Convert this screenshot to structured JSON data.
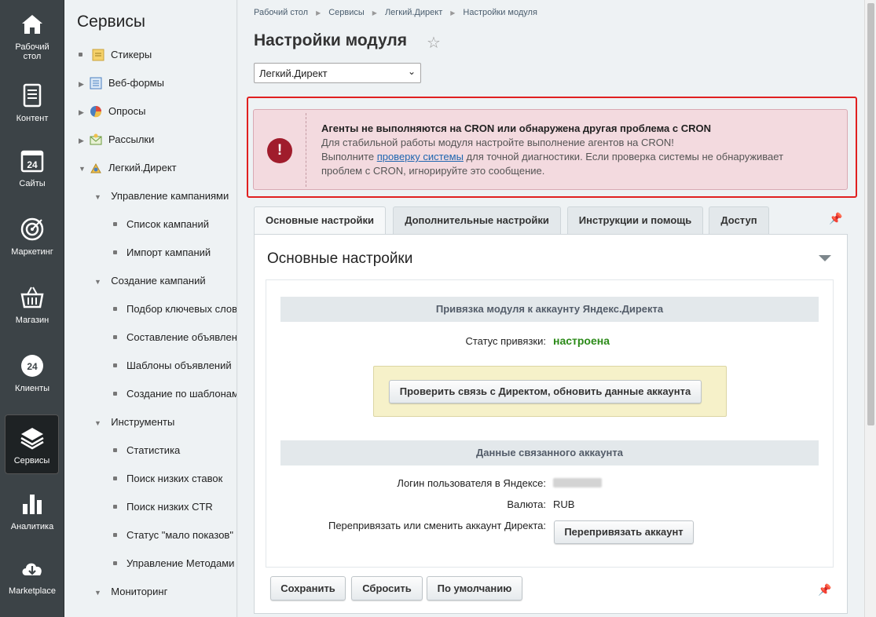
{
  "rail": [
    {
      "label_l1": "Рабочий",
      "label_l2": "стол",
      "icon": "home-icon"
    },
    {
      "label_l1": "Контент",
      "label_l2": "",
      "icon": "document-icon"
    },
    {
      "label_l1": "Сайты",
      "label_l2": "",
      "icon": "calendar-24-icon",
      "icon_text": "24"
    },
    {
      "label_l1": "Маркетинг",
      "label_l2": "",
      "icon": "target-icon"
    },
    {
      "label_l1": "Магазин",
      "label_l2": "",
      "icon": "basket-icon"
    },
    {
      "label_l1": "Клиенты",
      "label_l2": "",
      "icon": "crm-24-icon",
      "icon_text": "24"
    },
    {
      "label_l1": "Сервисы",
      "label_l2": "",
      "icon": "layers-icon"
    },
    {
      "label_l1": "Аналитика",
      "label_l2": "",
      "icon": "bar-chart-icon"
    },
    {
      "label_l1": "Marketplace",
      "label_l2": "",
      "icon": "cloud-download-icon"
    }
  ],
  "tree": {
    "title": "Сервисы",
    "items": [
      {
        "label": "Стикеры"
      },
      {
        "label": "Веб-формы"
      },
      {
        "label": "Опросы"
      },
      {
        "label": "Рассылки"
      },
      {
        "label": "Легкий.Директ"
      },
      {
        "label": "Управление кампаниями"
      },
      {
        "label": "Список кампаний"
      },
      {
        "label": "Импорт кампаний"
      },
      {
        "label": "Создание кампаний"
      },
      {
        "label": "Подбор ключевых слов"
      },
      {
        "label": "Составление объявлений"
      },
      {
        "label": "Шаблоны объявлений"
      },
      {
        "label": "Создание по шаблонам"
      },
      {
        "label": "Инструменты"
      },
      {
        "label": "Статистика"
      },
      {
        "label": "Поиск низких ставок"
      },
      {
        "label": "Поиск низких CTR"
      },
      {
        "label": "Статус \"мало показов\""
      },
      {
        "label": "Управление Методами"
      },
      {
        "label": "Мониторинг"
      }
    ]
  },
  "breadcrumb": [
    "Рабочий стол",
    "Сервисы",
    "Легкий.Директ",
    "Настройки модуля"
  ],
  "page": {
    "title": "Настройки модуля",
    "module_select": "Легкий.Директ"
  },
  "alert": {
    "title": "Агенты не выполняются на CRON или обнаружена другая проблема с CRON",
    "line1": "Для стабильной работы модуля настройте выполнение агентов на CRON!",
    "line2_pre": "Выполните ",
    "line2_link": "проверку системы",
    "line2_post": " для точной диагностики. Если проверка системы не обнаруживает",
    "line3": "проблем с CRON, игнорируйте это сообщение."
  },
  "tabs": [
    "Основные настройки",
    "Дополнительные настройки",
    "Инструкции и помощь",
    "Доступ"
  ],
  "panel": {
    "title": "Основные настройки",
    "section1": "Привязка модуля к аккаунту Яндекс.Директа",
    "status_label": "Статус привязки:",
    "status_value": "настроена",
    "check_button": "Проверить связь с Директом, обновить данные аккаунта",
    "section2": "Данные связанного аккаунта",
    "login_label": "Логин пользователя в Яндексе:",
    "currency_label": "Валюта:",
    "currency_value": "RUB",
    "rebind_label": "Перепривязать или сменить аккаунт Директа:",
    "rebind_button": "Перепривязать аккаунт"
  },
  "footer": {
    "save": "Сохранить",
    "reset": "Сбросить",
    "default": "По умолчанию"
  },
  "colors": {
    "rail_bg": "#3c4347",
    "alert_bg": "#f3dadf",
    "alert_icon": "#a01c2c",
    "status_ok": "#2b8a18",
    "highlight_box": "#f6f1c9"
  }
}
